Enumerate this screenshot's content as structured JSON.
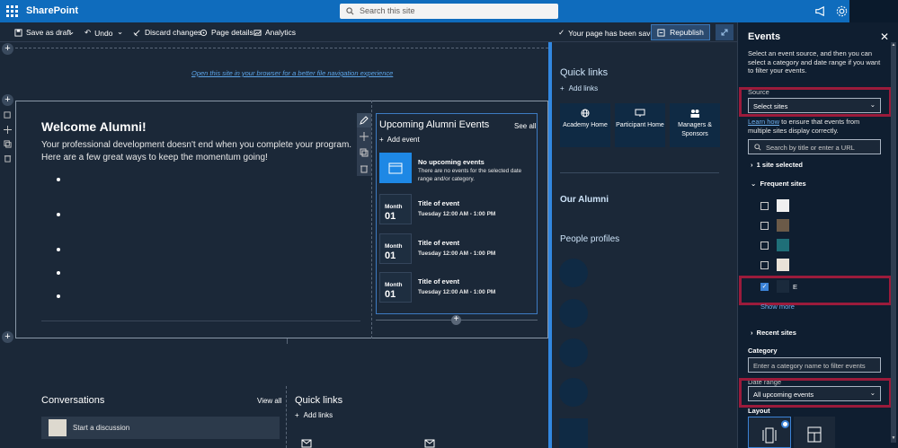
{
  "topbar": {
    "brand": "SharePoint",
    "search_placeholder": "Search this site"
  },
  "cmdbar": {
    "save_draft": "Save as draft",
    "undo": "Undo",
    "discard": "Discard changes",
    "page_details": "Page details",
    "analytics": "Analytics",
    "saved_status": "Your page has been saved",
    "republish": "Republish"
  },
  "canvas": {
    "open_link": "Open this site in your browser for a better file navigation experience",
    "welcome_title": "Welcome Alumni!",
    "welcome_body": "Your professional development doesn't end when you complete your program. Here are a few great ways to keep the momentum going!",
    "events": {
      "title": "Upcoming Alumni Events",
      "see_all": "See all",
      "add_event": "Add event",
      "no_events_title": "No upcoming events",
      "no_events_desc": "There are no events for the selected date range and/or category.",
      "items": [
        {
          "month": "Month",
          "day": "01",
          "title": "Title of event",
          "time": "Tuesday 12:00 AM - 1:00 PM"
        },
        {
          "month": "Month",
          "day": "01",
          "title": "Title of event",
          "time": "Tuesday 12:00 AM - 1:00 PM"
        },
        {
          "month": "Month",
          "day": "01",
          "title": "Title of event",
          "time": "Tuesday 12:00 AM - 1:00 PM"
        }
      ]
    },
    "conversations": {
      "title": "Conversations",
      "view_all": "View all",
      "start": "Start a discussion"
    },
    "quick_links_bottom": {
      "title": "Quick links",
      "add": "Add links"
    }
  },
  "right_col": {
    "quick_links": "Quick links",
    "add_links": "Add links",
    "tiles": [
      "Academy Home",
      "Participant Home",
      "Managers & Sponsors"
    ],
    "our_alumni": "Our Alumni",
    "people_profiles": "People profiles"
  },
  "panel": {
    "title": "Events",
    "intro": "Select an event source, and then you can select a category and date range if you want to filter your events.",
    "source_label": "Source",
    "source_value": "Select sites",
    "learn_how": "Learn how",
    "learn_how_rest": " to ensure that events from multiple sites display correctly.",
    "search_placeholder": "Search by title or enter a URL",
    "sites_selected": "1 site selected",
    "frequent_sites": "Frequent sites",
    "selected_site_letter": "E",
    "show_more": "Show more",
    "recent_sites": "Recent sites",
    "category_label": "Category",
    "category_placeholder": "Enter a category name to filter events",
    "date_range_label": "Date range",
    "date_range_value": "All upcoming events",
    "layout_label": "Layout"
  }
}
